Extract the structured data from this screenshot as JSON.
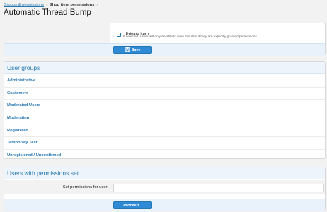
{
  "breadcrumb": {
    "items": [
      "Groups & permissions",
      "Shop item permissions"
    ],
    "separator": "›"
  },
  "page_title": "Automatic Thread Bump",
  "options": {
    "private_item_label": "Private item",
    "private_item_checked": false,
    "private_item_hint": "If selected, users will only be able to view this item if they are explicitly granted permissions."
  },
  "save_button": {
    "icon": "save-icon",
    "label": "Save"
  },
  "user_groups": {
    "heading": "User groups",
    "items": [
      "Administrative",
      "Customers",
      "Moderated Users",
      "Moderating",
      "Registered",
      "Temporary Test",
      "Unregistered / Unconfirmed"
    ]
  },
  "users_with_permissions": {
    "heading": "Users with permissions set",
    "field_label": "Set permissions for user:",
    "field_value": "",
    "proceed_label": "Proceed..."
  },
  "colors": {
    "link": "#2577b1",
    "button": "#2f8ad6",
    "header_bg": "#edf4fb",
    "page_bg": "#f2f2f2"
  }
}
